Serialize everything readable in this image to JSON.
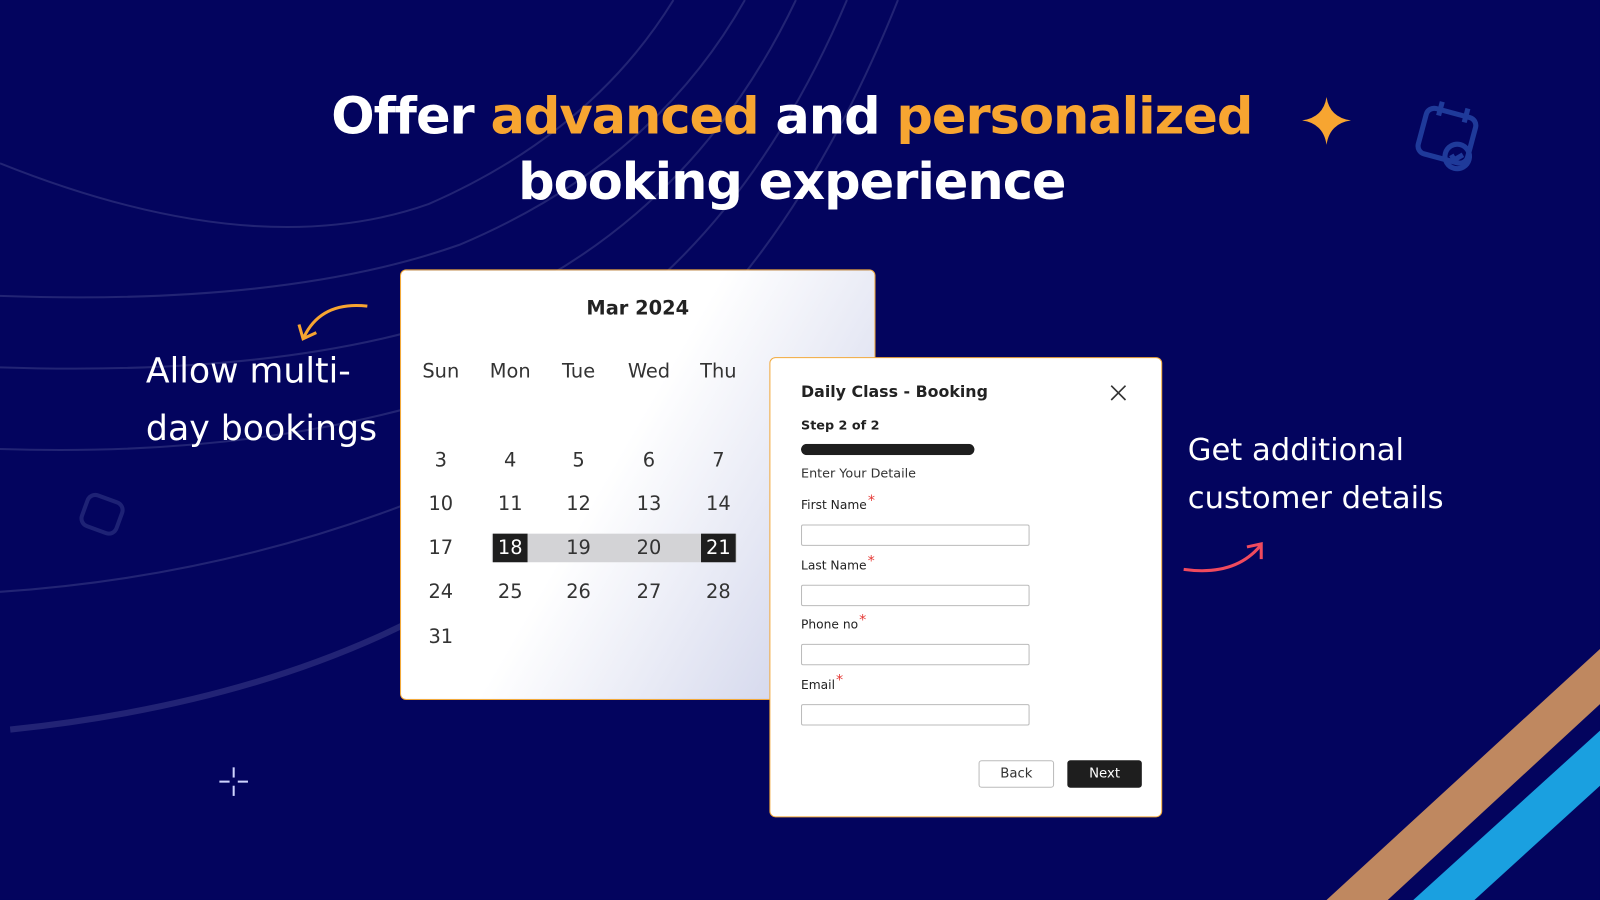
{
  "headline": {
    "w1": "Offer",
    "w2": "advanced",
    "w3": "and",
    "w4": "personalized",
    "line2": "booking experience"
  },
  "left_caption": {
    "line1": "Allow multi-",
    "line2": "day bookings"
  },
  "right_caption": {
    "line1": "Get additional",
    "line2": "customer details"
  },
  "colors": {
    "background": "#03045e",
    "accent": "#f7a531",
    "selected": "#1e1e1e",
    "required": "#e53935"
  },
  "calendar": {
    "title": "Mar 2024",
    "weekdays": [
      "Sun",
      "Mon",
      "Tue",
      "Wed",
      "Thu"
    ],
    "weeks": [
      [
        "3",
        "4",
        "5",
        "6",
        "7"
      ],
      [
        "10",
        "11",
        "12",
        "13",
        "14"
      ],
      [
        "17",
        "18",
        "19",
        "20",
        "21"
      ],
      [
        "24",
        "25",
        "26",
        "27",
        "28"
      ],
      [
        "31"
      ]
    ],
    "range_start": "18",
    "range_end": "21"
  },
  "modal": {
    "title": "Daily Class - Booking",
    "close_icon": "close-icon",
    "step": "Step 2 of 2",
    "progress": 1.0,
    "subtitle": "Enter Your Detaile",
    "fields": [
      {
        "label": "First Name",
        "value": ""
      },
      {
        "label": "Last Name",
        "value": ""
      },
      {
        "label": "Phone no",
        "value": ""
      },
      {
        "label": "Email",
        "value": ""
      }
    ],
    "required_mark": "*",
    "back": "Back",
    "next": "Next"
  }
}
